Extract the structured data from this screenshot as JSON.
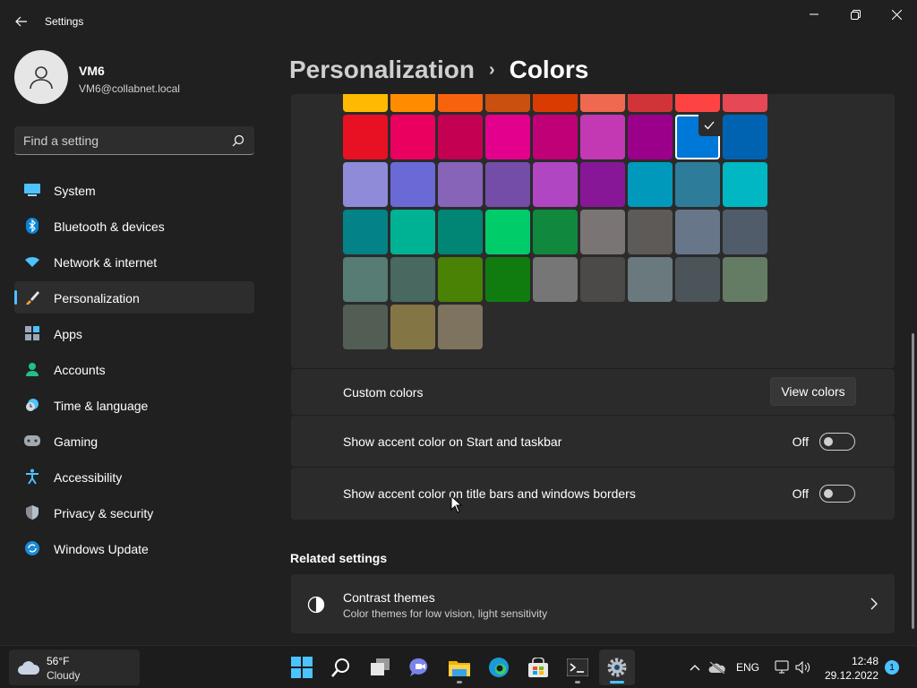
{
  "window": {
    "title": "Settings",
    "back_icon": "arrow-left-icon",
    "controls": [
      "minimize-icon",
      "maximize-icon",
      "close-icon"
    ]
  },
  "user": {
    "name": "VM6",
    "email": "VM6@collabnet.local"
  },
  "search": {
    "placeholder": "Find a setting"
  },
  "sidebar": {
    "items": [
      {
        "label": "System",
        "icon": "monitor-icon",
        "active": false
      },
      {
        "label": "Bluetooth & devices",
        "icon": "bluetooth-icon",
        "active": false
      },
      {
        "label": "Network & internet",
        "icon": "wifi-icon",
        "active": false
      },
      {
        "label": "Personalization",
        "icon": "brush-icon",
        "active": true
      },
      {
        "label": "Apps",
        "icon": "apps-icon",
        "active": false
      },
      {
        "label": "Accounts",
        "icon": "person-icon",
        "active": false
      },
      {
        "label": "Time & language",
        "icon": "clock-globe-icon",
        "active": false
      },
      {
        "label": "Gaming",
        "icon": "gamepad-icon",
        "active": false
      },
      {
        "label": "Accessibility",
        "icon": "accessibility-icon",
        "active": false
      },
      {
        "label": "Privacy & security",
        "icon": "shield-icon",
        "active": false
      },
      {
        "label": "Windows Update",
        "icon": "update-icon",
        "active": false
      }
    ]
  },
  "breadcrumb": {
    "parent": "Personalization",
    "separator": "›",
    "current": "Colors"
  },
  "palette": {
    "rows": [
      [
        "#FFB900",
        "#FF8C00",
        "#F7630C",
        "#CA5010",
        "#DA3B01",
        "#EF6950",
        "#D13438",
        "#FF4343",
        "#E74856"
      ],
      [
        "#E81123",
        "#EA005E",
        "#C30052",
        "#E3008C",
        "#BF0077",
        "#C239B3",
        "#9A0089",
        "#0078D7",
        "#0063B1"
      ],
      [
        "#8E8CD8",
        "#6B69D6",
        "#8764B8",
        "#744DA9",
        "#B146C2",
        "#881798",
        "#0099BC",
        "#2D7D9A",
        "#00B7C3"
      ],
      [
        "#038387",
        "#00B294",
        "#018574",
        "#00CC6A",
        "#10893E",
        "#7A7574",
        "#5D5A58",
        "#68768A",
        "#515C6B"
      ],
      [
        "#567C73",
        "#486860",
        "#498205",
        "#107C10",
        "#767676",
        "#4C4A48",
        "#69797E",
        "#4A5459",
        "#647C64"
      ],
      [
        "#525E54",
        "#847545",
        "#7E735F"
      ]
    ],
    "selected": {
      "row": 1,
      "col": 7
    }
  },
  "custom_colors": {
    "label": "Custom colors",
    "button": "View colors"
  },
  "toggles": [
    {
      "label": "Show accent color on Start and taskbar",
      "state": "Off"
    },
    {
      "label": "Show accent color on title bars and windows borders",
      "state": "Off"
    }
  ],
  "related": {
    "title": "Related settings",
    "items": [
      {
        "title": "Contrast themes",
        "subtitle": "Color themes for low vision, light sensitivity",
        "icon": "contrast-icon"
      }
    ]
  },
  "taskbar": {
    "weather": {
      "temp": "56°F",
      "condition": "Cloudy",
      "icon": "cloud-icon"
    },
    "apps": [
      "windows-start-icon",
      "search-icon",
      "task-view-icon",
      "chat-icon",
      "file-explorer-icon",
      "edge-icon",
      "store-icon",
      "terminal-icon",
      "settings-gear-icon"
    ],
    "tray": {
      "language": "ENG"
    },
    "time": "12:48",
    "date": "29.12.2022",
    "notification_count": "1"
  },
  "colors": {
    "accent": "#4cc2ff",
    "background": "#202020",
    "card": "#2b2b2b"
  }
}
